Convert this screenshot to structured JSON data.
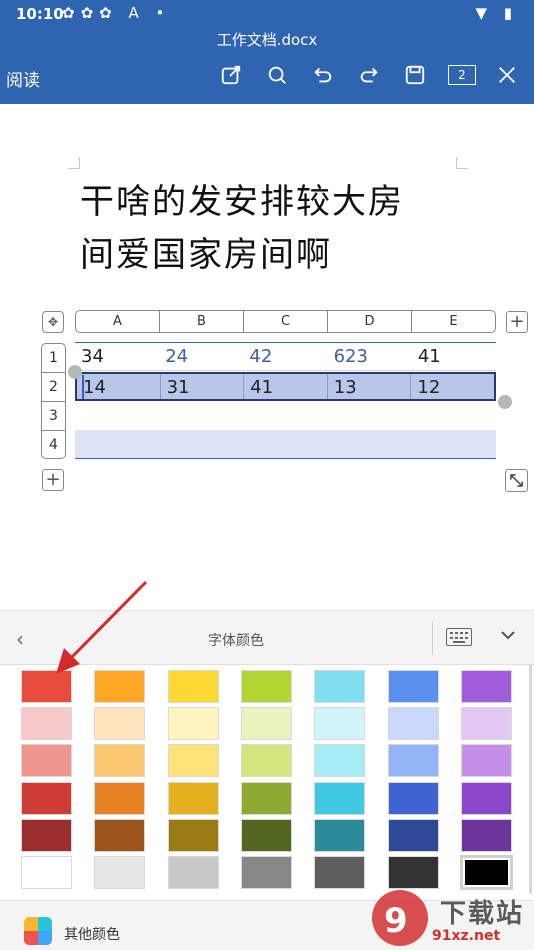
{
  "status_bar": {
    "time": "10:10",
    "icons": "✿✿✿ A •",
    "right_icons": "▼ ▮"
  },
  "doc_title": "工作文档.docx",
  "mode_label": "阅读",
  "toolbar": {
    "buttons": [
      "edit-icon",
      "search-icon",
      "undo-icon",
      "redo-icon",
      "save-icon",
      "page-count",
      "close-icon"
    ],
    "page_count": "2"
  },
  "document": {
    "heading_line1": "干啥的发安排较大房",
    "heading_line2": "间爱国家房间啊"
  },
  "table": {
    "columns": [
      "A",
      "B",
      "C",
      "D",
      "E"
    ],
    "rows": [
      "1",
      "2",
      "3",
      "4"
    ],
    "cells": [
      [
        "34",
        "24",
        "42",
        "623",
        "41"
      ],
      [
        "14",
        "31",
        "41",
        "13",
        "12"
      ],
      [
        "",
        "",
        "",
        "",
        ""
      ],
      [
        "",
        "",
        "",
        "",
        ""
      ]
    ],
    "selected_row": 2
  },
  "panel": {
    "title": "字体颜色",
    "more_colors_label": "其他颜色",
    "palette": [
      [
        "#e84c3d",
        "#ffa726",
        "#fdd835",
        "#b2d732",
        "#7ee0f2",
        "#5b8ff0",
        "#a25ddc"
      ],
      [
        "#f8c9c9",
        "#ffe3bd",
        "#fff3c0",
        "#e9f4be",
        "#d1f5f8",
        "#c9d9fb",
        "#e3c8f3"
      ],
      [
        "#ef958f",
        "#fbc86f",
        "#fde277",
        "#d1e67d",
        "#a6ecf5",
        "#93b5f7",
        "#c58fe7"
      ],
      [
        "#cf3b35",
        "#e68222",
        "#e3b01f",
        "#8daa31",
        "#41c9e4",
        "#3f63d1",
        "#8b46c9"
      ],
      [
        "#9b2d2d",
        "#9b551c",
        "#9a7a13",
        "#52661f",
        "#2b8b9a",
        "#2e4a96",
        "#6c369c"
      ],
      [
        "#ffffff",
        "#e6e6e6",
        "#c8c8c8",
        "#878787",
        "#5f5f5f",
        "#333333",
        "#000000"
      ]
    ],
    "selected_swatch": "#000000"
  },
  "watermark": {
    "text": "下载站",
    "url": "91xz.net"
  },
  "annotation_color": "#d52a2a"
}
